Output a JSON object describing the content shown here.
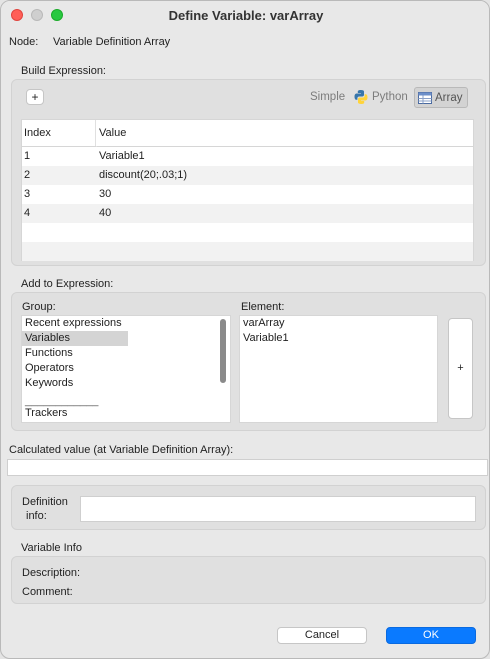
{
  "window": {
    "title": "Define Variable: varArray"
  },
  "node": {
    "label": "Node:",
    "value": "Variable Definition Array"
  },
  "build": {
    "label": "Build Expression:",
    "add_button": "+",
    "modes": {
      "simple": "Simple",
      "python": "Python",
      "array": "Array"
    },
    "table": {
      "headers": [
        "Index",
        "Value"
      ],
      "rows": [
        {
          "index": "1",
          "value": "Variable1"
        },
        {
          "index": "2",
          "value": "discount(20;.03;1)"
        },
        {
          "index": "3",
          "value": "30"
        },
        {
          "index": "4",
          "value": "40"
        }
      ]
    }
  },
  "add_to_expression": {
    "label": "Add to Expression:",
    "group_label": "Group:",
    "groups": [
      "Recent expressions",
      "Variables",
      "Functions",
      "Operators",
      "Keywords",
      "____________",
      "Trackers"
    ],
    "selected_group": "Variables",
    "element_label": "Element:",
    "elements": [
      "varArray",
      "Variable1"
    ],
    "add_button": "+"
  },
  "calculated": {
    "label": "Calculated value (at Variable Definition Array):",
    "value": ""
  },
  "definition_info": {
    "label_line1": "Definition",
    "label_line2": "info:",
    "value": ""
  },
  "variable_info": {
    "label": "Variable Info",
    "description_label": "Description:",
    "comment_label": "Comment:"
  },
  "buttons": {
    "cancel": "Cancel",
    "ok": "OK"
  },
  "colors": {
    "accent": "#0a7aff",
    "selection": "#d4d4d4"
  }
}
